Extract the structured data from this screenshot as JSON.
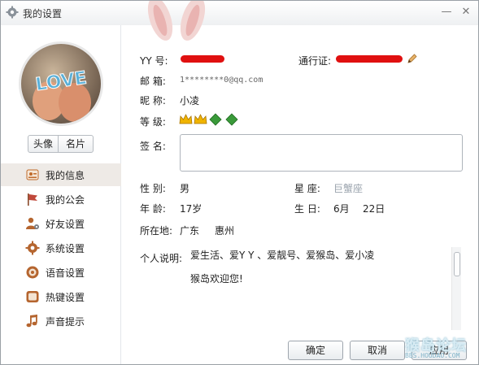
{
  "window": {
    "title": "我的设置",
    "minimize_glyph": "—",
    "close_glyph": "✕"
  },
  "avatar": {
    "text": "LOVE"
  },
  "avatar_buttons": [
    "头像",
    "名片"
  ],
  "nav": [
    {
      "label": "我的信息",
      "icon": "id-card-icon",
      "active": true
    },
    {
      "label": "我的公会",
      "icon": "flag-icon",
      "active": false
    },
    {
      "label": "好友设置",
      "icon": "friend-settings-icon",
      "active": false
    },
    {
      "label": "系统设置",
      "icon": "gear-icon",
      "active": false
    },
    {
      "label": "语音设置",
      "icon": "speaker-icon",
      "active": false
    },
    {
      "label": "热键设置",
      "icon": "hotkey-icon",
      "active": false
    },
    {
      "label": "声音提示",
      "icon": "music-note-icon",
      "active": false
    }
  ],
  "profile": {
    "yy_label": "YY  号:",
    "passport_label": "通行证:",
    "email_label": "邮  箱:",
    "email_value": "1********0@qq.com",
    "nickname_label": "昵  称:",
    "nickname_value": "小凌",
    "level_label": "等  级:",
    "signature_label": "签  名:",
    "gender_label": "性  别:",
    "gender_value": "男",
    "constellation_label": "星  座:",
    "constellation_value": "巨蟹座",
    "age_label": "年  龄:",
    "age_value": "17岁",
    "birthday_label": "生  日:",
    "birthday_month": "6月",
    "birthday_day": "22日",
    "location_label": "所在地:",
    "location_province": "广东",
    "location_city": "惠州",
    "about_label": "个人说明:",
    "about_line1": "爱生活、爱Y Y 、爱靓号、爱猴岛、爱小凌",
    "about_line2": "猴岛欢迎您!"
  },
  "buttons": {
    "ok": "确定",
    "cancel": "取消",
    "apply": "应用"
  },
  "watermark": {
    "text": "猴岛论坛",
    "url": "BBS.HOUDAO.COM"
  },
  "colors": {
    "redaction": "#e01010",
    "active_nav_bg": "#eeeae6",
    "crown_gold": "#f0b400",
    "leaf_green": "#3a9a3a"
  }
}
